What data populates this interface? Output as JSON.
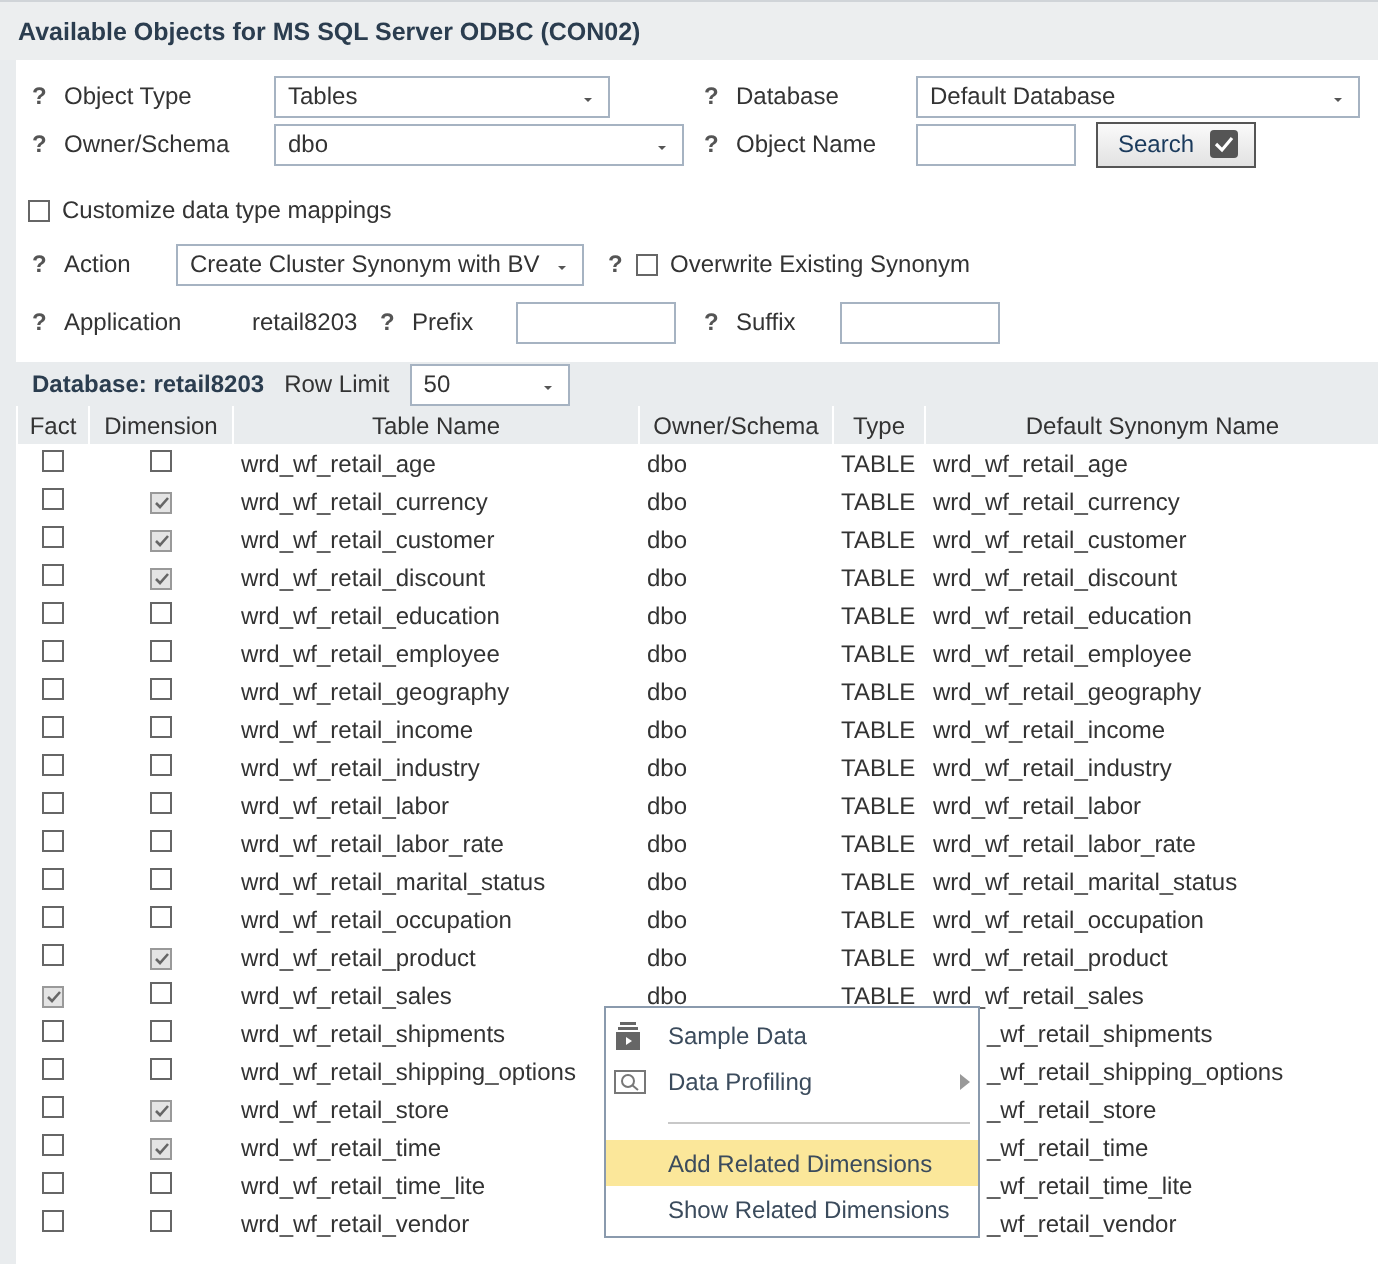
{
  "header": {
    "title": "Available Objects for MS SQL Server ODBC (CON02)"
  },
  "form": {
    "object_type": {
      "help": "?",
      "label": "Object Type",
      "value": "Tables"
    },
    "database": {
      "help": "?",
      "label": "Database",
      "value": "Default Database"
    },
    "owner_schema": {
      "help": "?",
      "label": "Owner/Schema",
      "value": "dbo"
    },
    "object_name": {
      "help": "?",
      "label": "Object Name"
    },
    "search_button": {
      "label": "Search"
    },
    "customize": {
      "label": "Customize data type mappings",
      "checked": false
    },
    "action": {
      "help": "?",
      "label": "Action",
      "value": "Create Cluster Synonym with BV"
    },
    "overwrite": {
      "help": "?",
      "label": "Overwrite Existing Synonym",
      "checked": false
    },
    "application": {
      "help": "?",
      "label": "Application",
      "value": "retail8203"
    },
    "prefix": {
      "help": "?",
      "label": "Prefix"
    },
    "suffix": {
      "help": "?",
      "label": "Suffix"
    }
  },
  "database_bar": {
    "title": "Database: retail8203",
    "row_limit_label": "Row Limit",
    "row_limit": "50"
  },
  "table": {
    "columns": [
      "Fact",
      "Dimension",
      "Table Name",
      "Owner/Schema",
      "Type",
      "Default Synonym Name"
    ],
    "rows": [
      {
        "fact": false,
        "dimension": false,
        "table_name": "wrd_wf_retail_age",
        "owner": "dbo",
        "type": "TABLE",
        "synonym": "wrd_wf_retail_age"
      },
      {
        "fact": false,
        "dimension": true,
        "table_name": "wrd_wf_retail_currency",
        "owner": "dbo",
        "type": "TABLE",
        "synonym": "wrd_wf_retail_currency"
      },
      {
        "fact": false,
        "dimension": true,
        "table_name": "wrd_wf_retail_customer",
        "owner": "dbo",
        "type": "TABLE",
        "synonym": "wrd_wf_retail_customer"
      },
      {
        "fact": false,
        "dimension": true,
        "table_name": "wrd_wf_retail_discount",
        "owner": "dbo",
        "type": "TABLE",
        "synonym": "wrd_wf_retail_discount"
      },
      {
        "fact": false,
        "dimension": false,
        "table_name": "wrd_wf_retail_education",
        "owner": "dbo",
        "type": "TABLE",
        "synonym": "wrd_wf_retail_education"
      },
      {
        "fact": false,
        "dimension": false,
        "table_name": "wrd_wf_retail_employee",
        "owner": "dbo",
        "type": "TABLE",
        "synonym": "wrd_wf_retail_employee"
      },
      {
        "fact": false,
        "dimension": false,
        "table_name": "wrd_wf_retail_geography",
        "owner": "dbo",
        "type": "TABLE",
        "synonym": "wrd_wf_retail_geography"
      },
      {
        "fact": false,
        "dimension": false,
        "table_name": "wrd_wf_retail_income",
        "owner": "dbo",
        "type": "TABLE",
        "synonym": "wrd_wf_retail_income"
      },
      {
        "fact": false,
        "dimension": false,
        "table_name": "wrd_wf_retail_industry",
        "owner": "dbo",
        "type": "TABLE",
        "synonym": "wrd_wf_retail_industry"
      },
      {
        "fact": false,
        "dimension": false,
        "table_name": "wrd_wf_retail_labor",
        "owner": "dbo",
        "type": "TABLE",
        "synonym": "wrd_wf_retail_labor"
      },
      {
        "fact": false,
        "dimension": false,
        "table_name": "wrd_wf_retail_labor_rate",
        "owner": "dbo",
        "type": "TABLE",
        "synonym": "wrd_wf_retail_labor_rate"
      },
      {
        "fact": false,
        "dimension": false,
        "table_name": "wrd_wf_retail_marital_status",
        "owner": "dbo",
        "type": "TABLE",
        "synonym": "wrd_wf_retail_marital_status"
      },
      {
        "fact": false,
        "dimension": false,
        "table_name": "wrd_wf_retail_occupation",
        "owner": "dbo",
        "type": "TABLE",
        "synonym": "wrd_wf_retail_occupation"
      },
      {
        "fact": false,
        "dimension": true,
        "table_name": "wrd_wf_retail_product",
        "owner": "dbo",
        "type": "TABLE",
        "synonym": "wrd_wf_retail_product"
      },
      {
        "fact": true,
        "dimension": false,
        "table_name": "wrd_wf_retail_sales",
        "owner": "dbo",
        "type": "TABLE",
        "synonym": "wrd_wf_retail_sales"
      },
      {
        "fact": false,
        "dimension": false,
        "table_name": "wrd_wf_retail_shipments",
        "synonym": "_wf_retail_shipments"
      },
      {
        "fact": false,
        "dimension": false,
        "table_name": "wrd_wf_retail_shipping_options",
        "synonym": "_wf_retail_shipping_options"
      },
      {
        "fact": false,
        "dimension": true,
        "table_name": "wrd_wf_retail_store",
        "synonym": "_wf_retail_store"
      },
      {
        "fact": false,
        "dimension": true,
        "table_name": "wrd_wf_retail_time",
        "synonym": "_wf_retail_time"
      },
      {
        "fact": false,
        "dimension": false,
        "table_name": "wrd_wf_retail_time_lite",
        "synonym": "_wf_retail_time_lite"
      },
      {
        "fact": false,
        "dimension": false,
        "table_name": "wrd_wf_retail_vendor",
        "synonym": "_wf_retail_vendor"
      }
    ]
  },
  "context_menu": {
    "items": [
      {
        "kind": "action",
        "label": "Sample Data",
        "selected": false
      },
      {
        "kind": "submenu",
        "label": "Data Profiling",
        "selected": false
      },
      {
        "kind": "separator"
      },
      {
        "kind": "action",
        "label": "Add Related Dimensions",
        "selected": true
      },
      {
        "kind": "action",
        "label": "Show Related Dimensions",
        "selected": false
      }
    ]
  }
}
